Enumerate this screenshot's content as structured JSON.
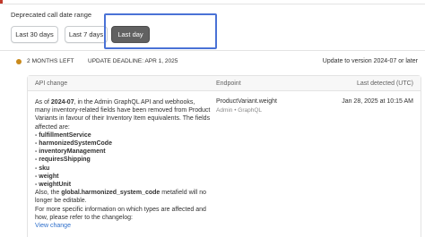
{
  "filter": {
    "label": "Deprecated call date range",
    "buttons": [
      "Last 30 days",
      "Last 7 days",
      "Last day"
    ],
    "selected": "Last day"
  },
  "status": {
    "months_left": "2 MONTHS LEFT",
    "deadline": "UPDATE DEADLINE: APR 1, 2025",
    "update_to": "Update to version 2024-07 or later"
  },
  "table": {
    "headers": {
      "api_change": "API change",
      "endpoint": "Endpoint",
      "last_detected": "Last detected (UTC)"
    },
    "row": {
      "intro_1": "As of ",
      "version": "2024-07",
      "intro_2": ", in the Admin GraphQL API and webhooks, many inventory-related fields have been removed from Product Variants in favour of their Inventory Item equivalents. The fields affected are:",
      "fields": [
        "- fulfillmentService",
        "- harmonizedSystemCode",
        "- inventoryManagement",
        "- requiresShipping",
        "- sku",
        "- weight",
        "- weightUnit"
      ],
      "also_1": "Also, the ",
      "also_field": "global.harmonized_system_code",
      "also_2": " metafield will no longer be editable.",
      "changelog": "For more specific information on which types are affected and how, please refer to the changelog:",
      "view_change": "View change",
      "endpoint": "ProductVariant.weight",
      "endpoint_sub": "Admin • GraphQL",
      "last_detected": "Jan 28, 2025 at 10:15 AM"
    }
  },
  "colors": {
    "accent_border": "#4a72d6",
    "selected_button": "#616161",
    "warning_dot": "#c98a1c",
    "link": "#2c6ecb"
  }
}
